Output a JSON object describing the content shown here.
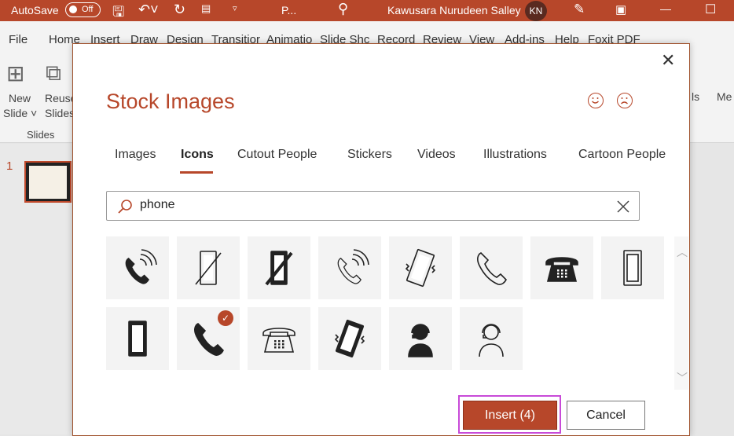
{
  "titlebar": {
    "autosave": "AutoSave",
    "toggle": "Off",
    "doc": "P...",
    "user": "Kawusara Nurudeen Salley",
    "initials": "KN",
    "color": "#b7472a"
  },
  "ribbon_tabs": [
    "File",
    "Home",
    "Insert",
    "Draw",
    "Design",
    "Transitior",
    "Animatio",
    "Slide Shc",
    "Record",
    "Review",
    "View",
    "Add-ins",
    "Help",
    "Foxit PDF"
  ],
  "ribbon": {
    "new_slide": [
      "New",
      "Slide ˅"
    ],
    "reuse": [
      "Reuse",
      "Slides"
    ],
    "group": "Slides",
    "partial_right": "ls",
    "media": "Me"
  },
  "slidepane": {
    "number": "1"
  },
  "dialog": {
    "title": "Stock Images",
    "tabs": [
      "Images",
      "Icons",
      "Cutout People",
      "Stickers",
      "Videos",
      "Illustrations",
      "Cartoon People"
    ],
    "active_tab": "Icons",
    "search_value": "phone",
    "icons": [
      {
        "name": "phone-ringing-icon",
        "selected": false
      },
      {
        "name": "mobile-off-outline-icon",
        "selected": false
      },
      {
        "name": "mobile-off-filled-icon",
        "selected": false
      },
      {
        "name": "phone-ringing-outline-icon",
        "selected": false
      },
      {
        "name": "mobile-vibrate-outline-icon",
        "selected": false
      },
      {
        "name": "phone-handset-outline-icon",
        "selected": false
      },
      {
        "name": "desk-phone-filled-icon",
        "selected": false
      },
      {
        "name": "mobile-outline-icon",
        "selected": false
      },
      {
        "name": "mobile-filled-icon",
        "selected": false
      },
      {
        "name": "phone-handset-filled-icon",
        "selected": true
      },
      {
        "name": "desk-phone-outline-icon",
        "selected": false
      },
      {
        "name": "mobile-vibrate-filled-icon",
        "selected": false
      },
      {
        "name": "headset-user-filled-icon",
        "selected": false
      },
      {
        "name": "headset-user-outline-icon",
        "selected": false
      }
    ],
    "insert_label": "Insert (4)",
    "cancel_label": "Cancel"
  }
}
